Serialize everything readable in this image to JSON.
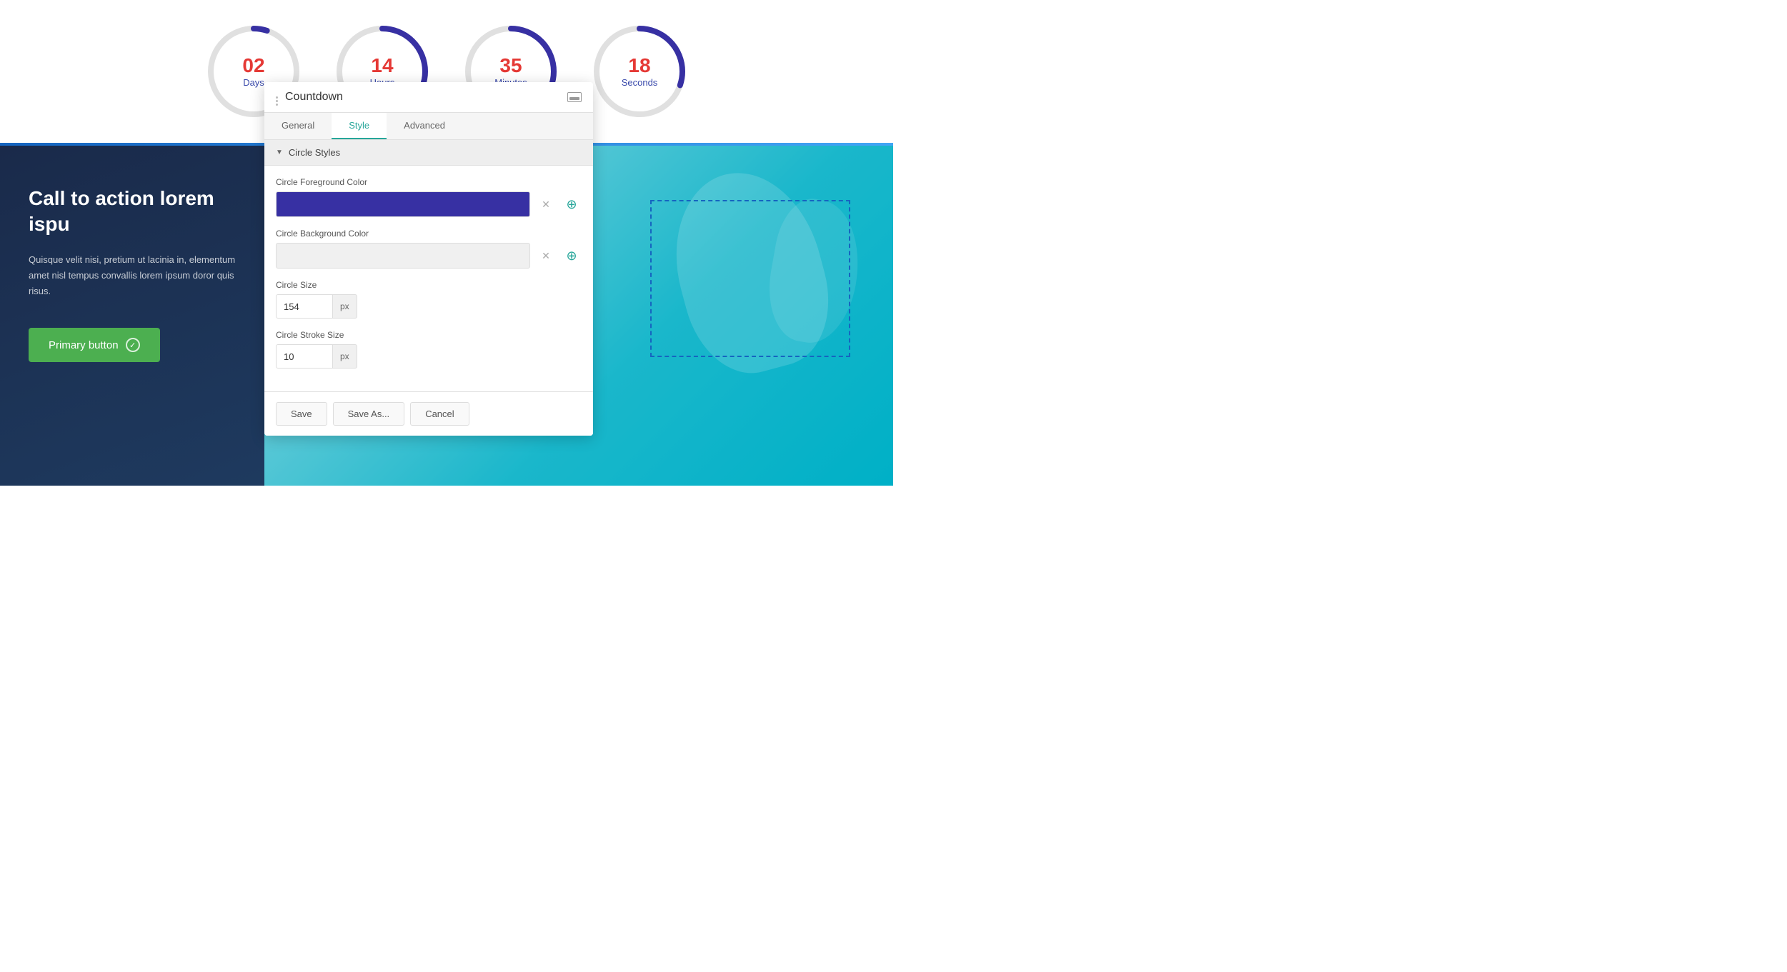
{
  "countdown": {
    "title": "Countdown",
    "items": [
      {
        "value": "02",
        "label": "Days",
        "progress": 0.05
      },
      {
        "value": "14",
        "label": "Hours",
        "progress": 0.58
      },
      {
        "value": "35",
        "label": "Minutes",
        "progress": 0.58
      },
      {
        "value": "18",
        "label": "Seconds",
        "progress": 0.3
      }
    ]
  },
  "left_panel": {
    "heading": "Call to action lorem ispu",
    "body": "Quisque velit nisi, pretium ut lacinia in, elementum amet nisl tempus convallis lorem ipsum doror quis risus.",
    "button_label": "Primary button"
  },
  "dialog": {
    "title": "Countdown",
    "tabs": [
      {
        "label": "General",
        "active": false
      },
      {
        "label": "Style",
        "active": true
      },
      {
        "label": "Advanced",
        "active": false
      }
    ],
    "section_label": "Circle Styles",
    "fields": {
      "fg_color_label": "Circle Foreground Color",
      "fg_color": "#3730a3",
      "bg_color_label": "Circle Background Color",
      "bg_color": "",
      "size_label": "Circle Size",
      "size_value": "154",
      "size_unit": "px",
      "stroke_label": "Circle Stroke Size",
      "stroke_value": "10",
      "stroke_unit": "px"
    },
    "footer": {
      "save": "Save",
      "save_as": "Save As...",
      "cancel": "Cancel"
    }
  }
}
